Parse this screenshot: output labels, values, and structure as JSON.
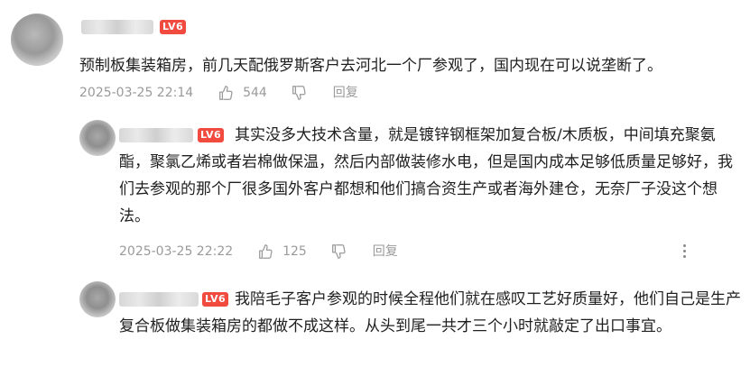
{
  "comments": [
    {
      "level_badge": "LV6",
      "text": "预制板集装箱房，前几天配俄罗斯客户去河北一个厂参观了，国内现在可以说垄断了。",
      "timestamp": "2025-03-25 22:14",
      "likes": "544",
      "reply_label": "回复"
    },
    {
      "level_badge": "LV6",
      "text": "其实没多大技术含量，就是镀锌钢框架加复合板/木质板，中间填充聚氨酯，聚氯乙烯或者岩棉做保温，然后内部做装修水电，但是国内成本足够低质量足够好，我们去参观的那个厂很多国外客户都想和他们搞合资生产或者海外建仓，无奈厂子没这个想法。",
      "timestamp": "2025-03-25 22:22",
      "likes": "125",
      "reply_label": "回复"
    },
    {
      "level_badge": "LV6",
      "text": "我陪毛子客户参观的时候全程他们就在感叹工艺好质量好，他们自己是生产复合板做集装箱房的都做不成这样。从头到尾一共才三个小时就敲定了出口事宜。"
    }
  ],
  "icons": [
    "thumb-up-icon",
    "thumb-down-icon",
    "more-icon"
  ],
  "colors": {
    "level_badge": "#f04b3e",
    "meta_text": "#9a9a9a",
    "body_text": "#1f1f1f"
  }
}
